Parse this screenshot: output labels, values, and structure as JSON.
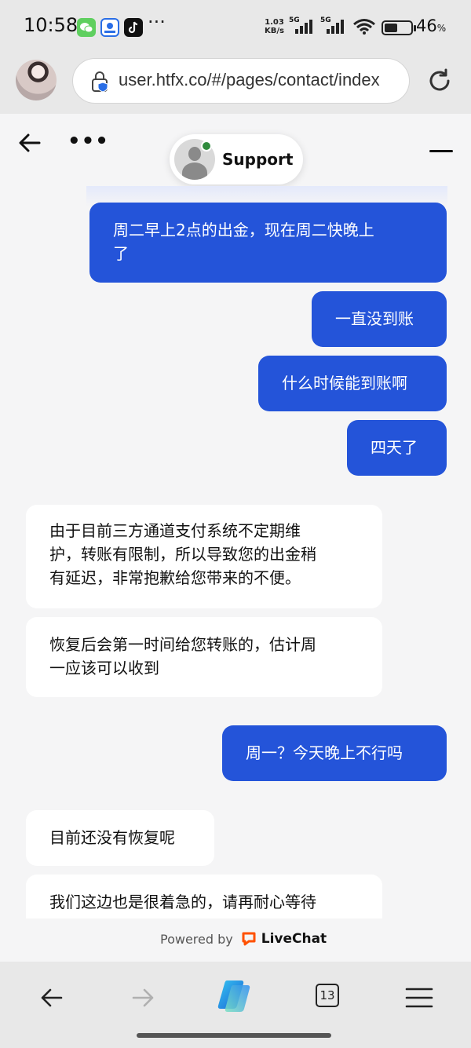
{
  "status_bar": {
    "time": "10:58",
    "more": "···",
    "net_speed_value": "1.03",
    "net_speed_unit": "KB/s",
    "sim1": "5G",
    "sim2": "5G",
    "battery_value": "46",
    "battery_unit": "%",
    "battery_level": 0.46
  },
  "browser": {
    "url": "user.htfx.co/#/pages/contact/index",
    "open_tabs": "13"
  },
  "chat": {
    "agent_name": "Support",
    "agent_online": true,
    "messages": [
      {
        "side": "out",
        "text": "周二早上2点的出金，现在周二快晚上\n了"
      },
      {
        "side": "out",
        "text": "一直没到账"
      },
      {
        "side": "out",
        "text": "什么时候能到账啊"
      },
      {
        "side": "out",
        "text": "四天了"
      },
      {
        "side": "in",
        "text": "由于目前三方通道支付系统不定期维\n护，转账有限制，所以导致您的出金稍\n有延迟，非常抱歉给您带来的不便。"
      },
      {
        "side": "in",
        "text": "恢复后会第一时间给您转账的，估计周\n一应该可以收到"
      },
      {
        "side": "out",
        "text": "周一？今天晚上不行吗"
      },
      {
        "side": "in",
        "text": "目前还没有恢复呢"
      },
      {
        "side": "in",
        "text": "我们这边也是很着急的，请再耐心等待"
      }
    ],
    "powered_by": "Powered by",
    "brand": "LiveChat"
  },
  "colors": {
    "accent": "#2454d9",
    "online": "#2f8a3c",
    "livechat_orange": "#ff5100"
  }
}
